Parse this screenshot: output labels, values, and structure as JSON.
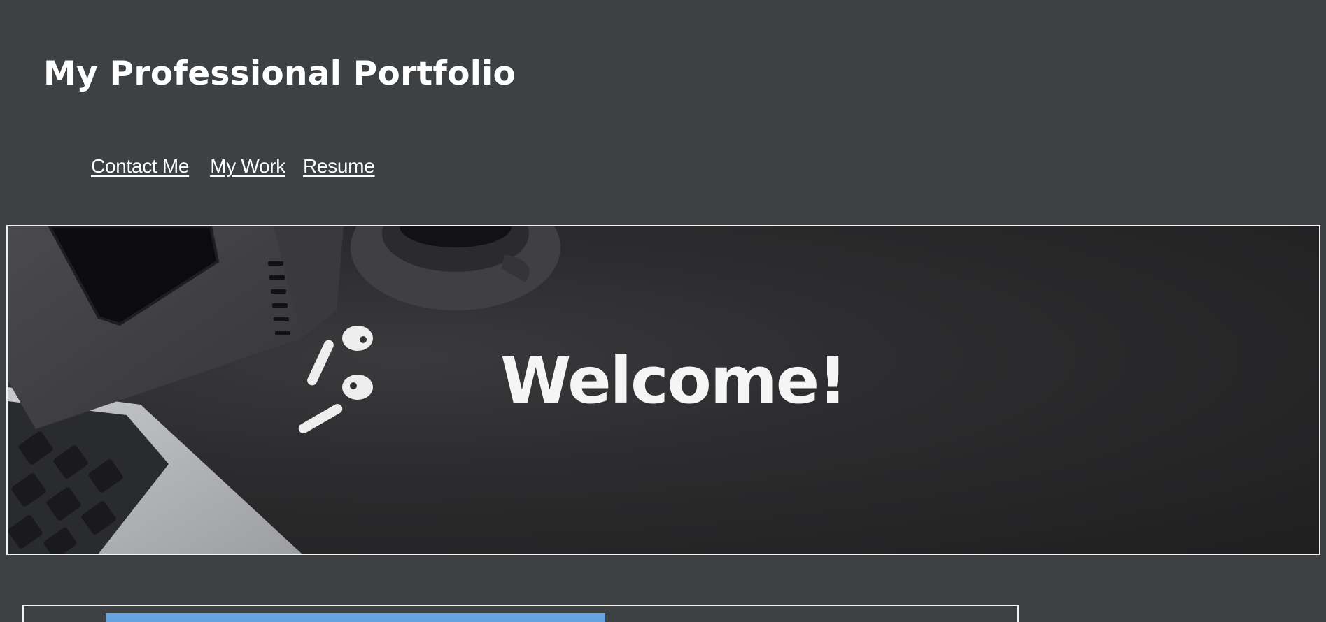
{
  "header": {
    "title": "My Professional Portfolio"
  },
  "nav": {
    "items": [
      {
        "label": "Contact Me"
      },
      {
        "label": "My Work"
      },
      {
        "label": "Resume"
      }
    ]
  },
  "hero": {
    "text": "Welcome!",
    "image_description_icons": [
      "phone-icon",
      "notebook-icon",
      "coffee-cup-icon",
      "earbuds-icon",
      "laptop-keyboard-icon"
    ]
  },
  "colors": {
    "background": "#3d4144",
    "text": "#ffffff",
    "border": "#f3f3f3",
    "thumb_blue": "#6aa6e3"
  }
}
